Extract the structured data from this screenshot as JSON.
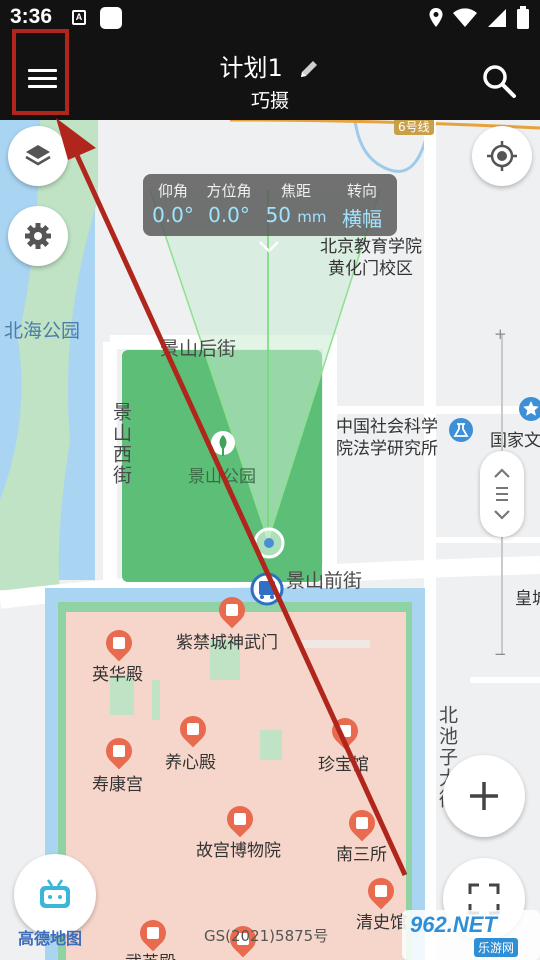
{
  "status_bar": {
    "time": "3:36",
    "notif_letter": "A"
  },
  "app_bar": {
    "title": "计划1",
    "subtitle": "巧摄"
  },
  "info_panel": {
    "elevation": {
      "label": "仰角",
      "value": "0.0°"
    },
    "azimuth": {
      "label": "方位角",
      "value": "0.0°"
    },
    "focal": {
      "label": "焦距",
      "value": "50",
      "unit": "mm"
    },
    "orientation": {
      "label": "转向",
      "value": "横幅"
    }
  },
  "map": {
    "labels": {
      "metro_line": "6号线",
      "school": "北京教育学院",
      "school_campus": "黄化门校区",
      "beihai_park": "北海公园",
      "jingshan_hou": "景山后街",
      "jingshan_xi": "景山西街",
      "jingshan_park": "景山公园",
      "jingshan_qian": "景山前街",
      "cass": "中国社会科学",
      "cass2": "院法学研究所",
      "national": "国家文",
      "huang": "皇城",
      "shenwumen": "紫禁城神武门",
      "wuhuadian": "英华殿",
      "yangxindian": "养心殿",
      "zhenbaoguan": "珍宝馆",
      "shoukanggong": "寿康宫",
      "palace_museum": "故宫博物院",
      "nansansuo": "南三所",
      "qingshiguan": "清史馆",
      "beichizi": "北池子大街",
      "wuyingdian": "武英殿"
    },
    "provider": "高德地图",
    "license": "GS(2021)5875号"
  },
  "watermark": {
    "big": "962.NET",
    "small": "乐游网"
  },
  "colors": {
    "park_green": "#5cbe77",
    "palace_pink": "#f6d6ca",
    "water": "#a9d5f3",
    "arrow": "#b0261d",
    "highlight_box": "#b0261d"
  }
}
